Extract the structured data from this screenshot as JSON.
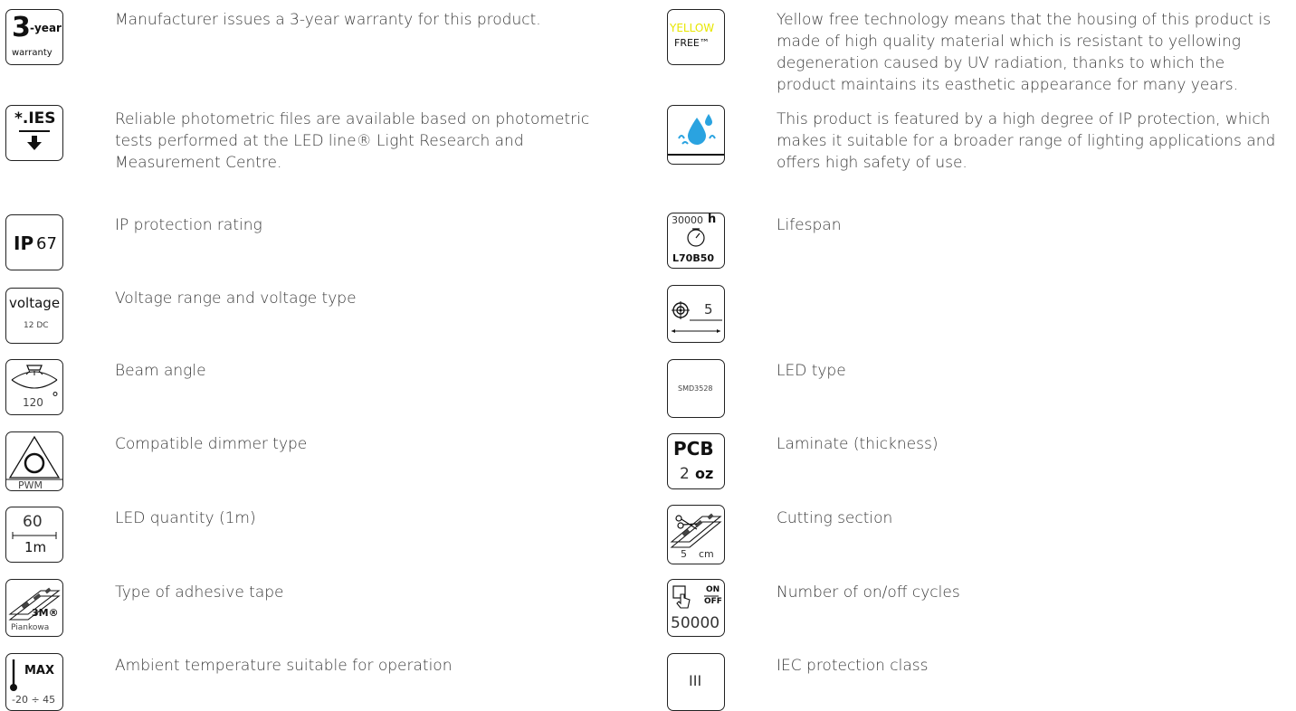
{
  "left": [
    {
      "key": "warranty",
      "text": "Manufacturer issues a 3-year warranty for this product.",
      "icon": {
        "big": "3",
        "suffix": "-year",
        "sub": "warranty"
      }
    },
    {
      "key": "ies",
      "text": "Reliable photometric files are available based on photometric tests performed at the LED line® Light Research and Measurement Centre.",
      "icon": {
        "label": "*.IES"
      }
    },
    {
      "key": "ip",
      "text": "IP protection rating",
      "icon": {
        "bold": "IP",
        "value": "67"
      }
    },
    {
      "key": "voltage",
      "text": "Voltage range and voltage type",
      "icon": {
        "label": "voltage",
        "value": "12 DC"
      }
    },
    {
      "key": "beam",
      "text": "Beam angle",
      "icon": {
        "value": "120",
        "unit": "°"
      }
    },
    {
      "key": "dimmer",
      "text": "Compatible dimmer type",
      "icon": {
        "value": "PWM"
      }
    },
    {
      "key": "ledqty",
      "text": "LED quantity (1m)",
      "icon": {
        "value": "60",
        "unit": "1m"
      }
    },
    {
      "key": "tape",
      "text": "Type of adhesive tape",
      "icon": {
        "brand": "3M®",
        "value": "Piankowa"
      }
    },
    {
      "key": "temp",
      "text": "Ambient temperature suitable for operation",
      "icon": {
        "label": "MAX",
        "value": "-20 ÷ 45"
      }
    }
  ],
  "right": [
    {
      "key": "yellow",
      "text": "Yellow free technology means that the housing of this product is made of high quality material which is resistant to yellowing degeneration caused by UV radiation, thanks to which the product maintains its easthetic appearance for many years.",
      "icon": {
        "top": "YELLOW",
        "bottom": "FREE™"
      }
    },
    {
      "key": "ipprot",
      "text": "This product is featured by a high degree of IP protection, which makes it suitable for a broader range of lighting applications and offers high safety of use.",
      "icon": {}
    },
    {
      "key": "lifespan",
      "text": "Lifespan",
      "icon": {
        "value": "30000",
        "unit": "h",
        "sub": "L70B50"
      }
    },
    {
      "key": "dist",
      "text": "",
      "icon": {
        "value": "5"
      }
    },
    {
      "key": "ledtype",
      "text": "LED type",
      "icon": {
        "value": "SMD3528"
      }
    },
    {
      "key": "laminate",
      "text": "Laminate (thickness)",
      "icon": {
        "label": "PCB",
        "value": "2",
        "unit": "oz"
      }
    },
    {
      "key": "cutting",
      "text": "Cutting section",
      "icon": {
        "value": "5",
        "unit": "cm"
      }
    },
    {
      "key": "cycles",
      "text": "Number of on/off cycles",
      "icon": {
        "on": "ON",
        "off": "OFF",
        "value": "50000"
      }
    },
    {
      "key": "iec",
      "text": "IEC protection class",
      "icon": {
        "value": "III"
      }
    }
  ],
  "colors": {
    "yellow_accent": "#e7e600",
    "water_blue": "#2aa3e0",
    "border": "#222222"
  }
}
